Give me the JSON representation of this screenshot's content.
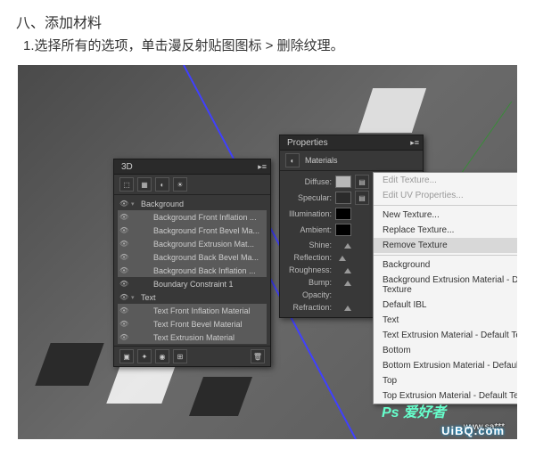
{
  "heading": "八、添加材料",
  "instruction": "1.选择所有的选项，单击漫反射贴图图标 > 删除纹理。",
  "panel3d": {
    "title": "3D",
    "items": [
      {
        "label": "Background",
        "twist": "▾",
        "sel": false
      },
      {
        "label": "Background Front Inflation ...",
        "indent": true,
        "sel": true
      },
      {
        "label": "Background Front Bevel Ma...",
        "indent": true,
        "sel": true
      },
      {
        "label": "Background Extrusion Mat...",
        "indent": true,
        "sel": true
      },
      {
        "label": "Background Back Bevel Ma...",
        "indent": true,
        "sel": true
      },
      {
        "label": "Background Back Inflation ...",
        "indent": true,
        "sel": true
      },
      {
        "label": "Boundary Constraint 1",
        "indent": true,
        "sel": false
      },
      {
        "label": "Text",
        "twist": "▾",
        "sel": false
      },
      {
        "label": "Text Front Inflation Material",
        "indent": true,
        "sel": true
      },
      {
        "label": "Text Front Bevel Material",
        "indent": true,
        "sel": true
      },
      {
        "label": "Text Extrusion Material",
        "indent": true,
        "sel": true
      }
    ]
  },
  "props": {
    "title": "Properties",
    "tab": "Materials",
    "rows": {
      "diffuse": "Diffuse:",
      "specular": "Specular:",
      "illumination": "Illumination:",
      "ambient": "Ambient:",
      "shine": "Shine:",
      "reflection": "Reflection:",
      "roughness": "Roughness:",
      "bump": "Bump:",
      "opacity": "Opacity:",
      "refraction": "Refraction:"
    },
    "colors": {
      "diffuse": "#b8b8b8",
      "specular": "#2b2b2b",
      "illumination": "#000000",
      "ambient": "#000000"
    }
  },
  "menu": {
    "items": [
      {
        "label": "Edit Texture...",
        "dis": true
      },
      {
        "label": "Edit UV Properties...",
        "dis": true
      },
      {
        "sep": true
      },
      {
        "label": "New Texture...",
        "dis": false
      },
      {
        "label": "Replace Texture...",
        "dis": false
      },
      {
        "label": "Remove Texture",
        "dis": false,
        "hov": true
      },
      {
        "sep": true
      },
      {
        "label": "Background",
        "dis": false
      },
      {
        "label": "Background Extrusion Material - Default Texture",
        "dis": false
      },
      {
        "label": "Default IBL",
        "dis": false
      },
      {
        "label": "Text",
        "dis": false
      },
      {
        "label": "Text Extrusion Material - Default Texture",
        "dis": false
      },
      {
        "label": "Bottom",
        "dis": false
      },
      {
        "label": "Bottom Extrusion Material - Default Texture",
        "dis": false
      },
      {
        "label": "Top",
        "dis": false
      },
      {
        "label": "Top Extrusion Material - Default Texture",
        "dis": false
      }
    ]
  },
  "watermark": {
    "logo": "Ps 爱好者",
    "site": "www.sa***"
  },
  "uibq": "UiBQ.com"
}
